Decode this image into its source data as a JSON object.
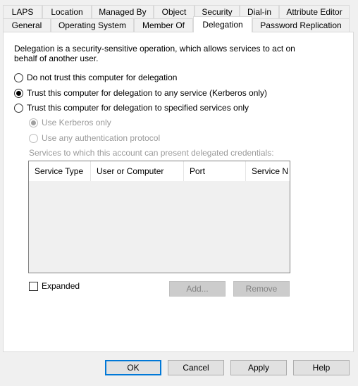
{
  "tabs_row1": [
    "LAPS",
    "Location",
    "Managed By",
    "Object",
    "Security",
    "Dial-in",
    "Attribute Editor"
  ],
  "tabs_row2": [
    "General",
    "Operating System",
    "Member Of",
    "Delegation",
    "Password Replication"
  ],
  "active_tab": "Delegation",
  "description_line1": "Delegation is a security-sensitive operation, which allows services to act on",
  "description_line2": "behalf of another user.",
  "options": {
    "no_trust": "Do not trust this computer for delegation",
    "trust_any": "Trust this computer for delegation to any service (Kerberos only)",
    "trust_specified": "Trust this computer for delegation to specified services only",
    "selected": "trust_any"
  },
  "sub_options": {
    "kerberos_only": "Use Kerberos only",
    "any_protocol": "Use any authentication protocol"
  },
  "services_label": "Services to which this account can present delegated credentials:",
  "columns": [
    "Service Type",
    "User or Computer",
    "Port",
    "Service N"
  ],
  "rows": [],
  "expanded_label": "Expanded",
  "expanded_checked": false,
  "buttons": {
    "add": "Add...",
    "remove": "Remove",
    "ok": "OK",
    "cancel": "Cancel",
    "apply": "Apply",
    "help": "Help"
  }
}
